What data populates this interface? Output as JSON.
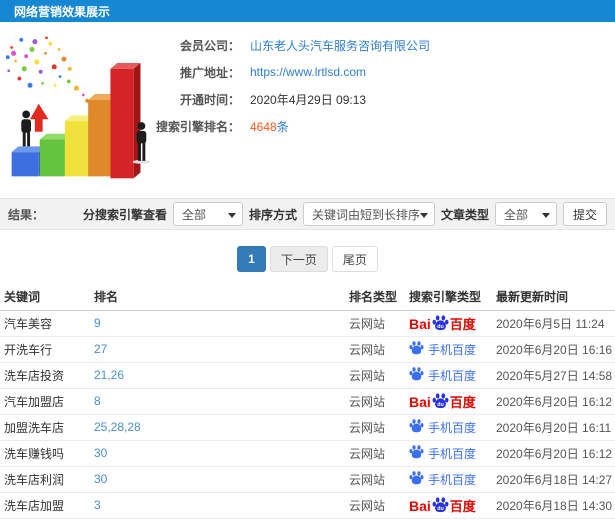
{
  "titlebar": {
    "title": "网络营销效果展示"
  },
  "info": {
    "company_label": "会员公司：",
    "company_value": "山东老人头汽车服务咨询有限公司",
    "url_label": "推广地址：",
    "url_value": "https://www.lrtlsd.com",
    "opened_label": "开通时间：",
    "opened_value": "2020年4月29日 09:13",
    "rank_label": "搜索引擎排名：",
    "rank_value": "4648",
    "rank_suffix": "条"
  },
  "filters": {
    "result_label": "结果：",
    "engine_label": "分搜索引擎查看",
    "engine_value": "全部",
    "sort_label": "排序方式",
    "sort_value": "关键词由短到长排序",
    "article_label": "文章类型",
    "article_value": "全部",
    "submit_label": "提交"
  },
  "pagination": {
    "current": "1",
    "next_label": "下一页",
    "last_label": "尾页"
  },
  "table": {
    "headers": [
      "关键词",
      "排名",
      "排名类型",
      "搜索引擎类型",
      "最新更新时间"
    ],
    "engine_logos": {
      "baidu_latin": "Bai",
      "baidu_du": "du",
      "baidu_cn": "百度",
      "mobile_label": "手机百度"
    },
    "rows": [
      {
        "keyword": "汽车美容",
        "rank": "9",
        "rank_type": "云网站",
        "engine": "baidu",
        "updated": "2020年6月5日 11:24"
      },
      {
        "keyword": "开洗车行",
        "rank": "27",
        "rank_type": "云网站",
        "engine": "mobile-baidu",
        "updated": "2020年6月20日 16:16"
      },
      {
        "keyword": "洗车店投资",
        "rank": "21,26",
        "rank_type": "云网站",
        "engine": "mobile-baidu",
        "updated": "2020年5月27日 14:58"
      },
      {
        "keyword": "汽车加盟店",
        "rank": "8",
        "rank_type": "云网站",
        "engine": "baidu",
        "updated": "2020年6月20日 16:12"
      },
      {
        "keyword": "加盟洗车店",
        "rank": "25,28,28",
        "rank_type": "云网站",
        "engine": "mobile-baidu",
        "updated": "2020年6月20日 16:11"
      },
      {
        "keyword": "洗车赚钱吗",
        "rank": "30",
        "rank_type": "云网站",
        "engine": "mobile-baidu",
        "updated": "2020年6月20日 16:12"
      },
      {
        "keyword": "洗车店利润",
        "rank": "30",
        "rank_type": "云网站",
        "engine": "mobile-baidu",
        "updated": "2020年6月18日 14:27"
      },
      {
        "keyword": "洗车店加盟",
        "rank": "3",
        "rank_type": "云网站",
        "engine": "baidu",
        "updated": "2020年6月18日 14:30"
      }
    ]
  },
  "colors": {
    "titlebar_blue": "#1587d3",
    "link_blue": "#2f7dd0",
    "rank_orange": "#ff5a1e",
    "pagination_active_blue": "#337ab7",
    "baidu_red": "#e10601",
    "baidu_paw_blue": "#2932e1",
    "mobile_baidu_blue": "#3b6ff0",
    "rank_cell_blue": "#4c8fce"
  }
}
